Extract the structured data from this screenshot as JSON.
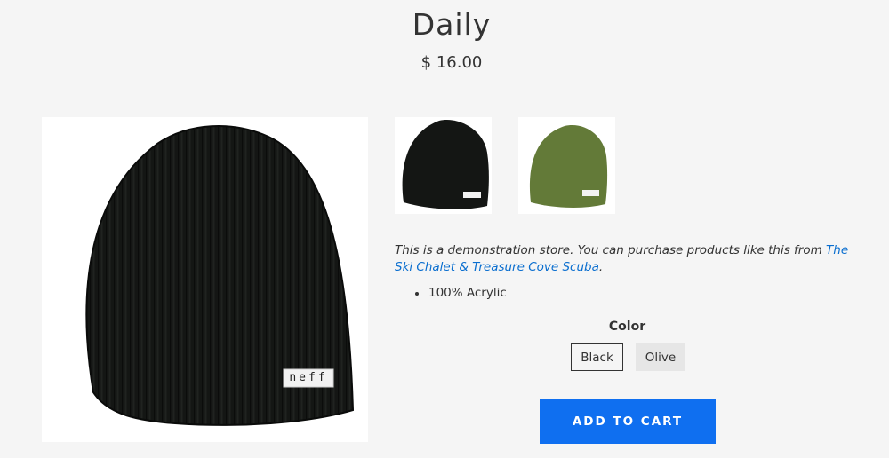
{
  "product": {
    "title": "Daily",
    "price": "$ 16.00",
    "description_text": "This is a demonstration store. You can purchase products like this from ",
    "description_link": "The Ski Chalet & Treasure Cove Scuba",
    "description_end": ".",
    "features": [
      "100% Acrylic"
    ]
  },
  "images": {
    "main": {
      "brand_tag": "neff",
      "color": "#141614"
    },
    "thumbnails": [
      {
        "color_name": "Black",
        "color": "#141614",
        "brand_tag": "neff"
      },
      {
        "color_name": "Olive",
        "color": "#637a38",
        "brand_tag": "neff"
      }
    ]
  },
  "options": {
    "color_label": "Color",
    "colors": [
      "Black",
      "Olive"
    ],
    "selected": "Black"
  },
  "actions": {
    "add_to_cart": "ADD TO CART"
  },
  "theme": {
    "accent": "#0f6ff0",
    "link": "#0a6ecf",
    "background": "#f5f5f5"
  }
}
